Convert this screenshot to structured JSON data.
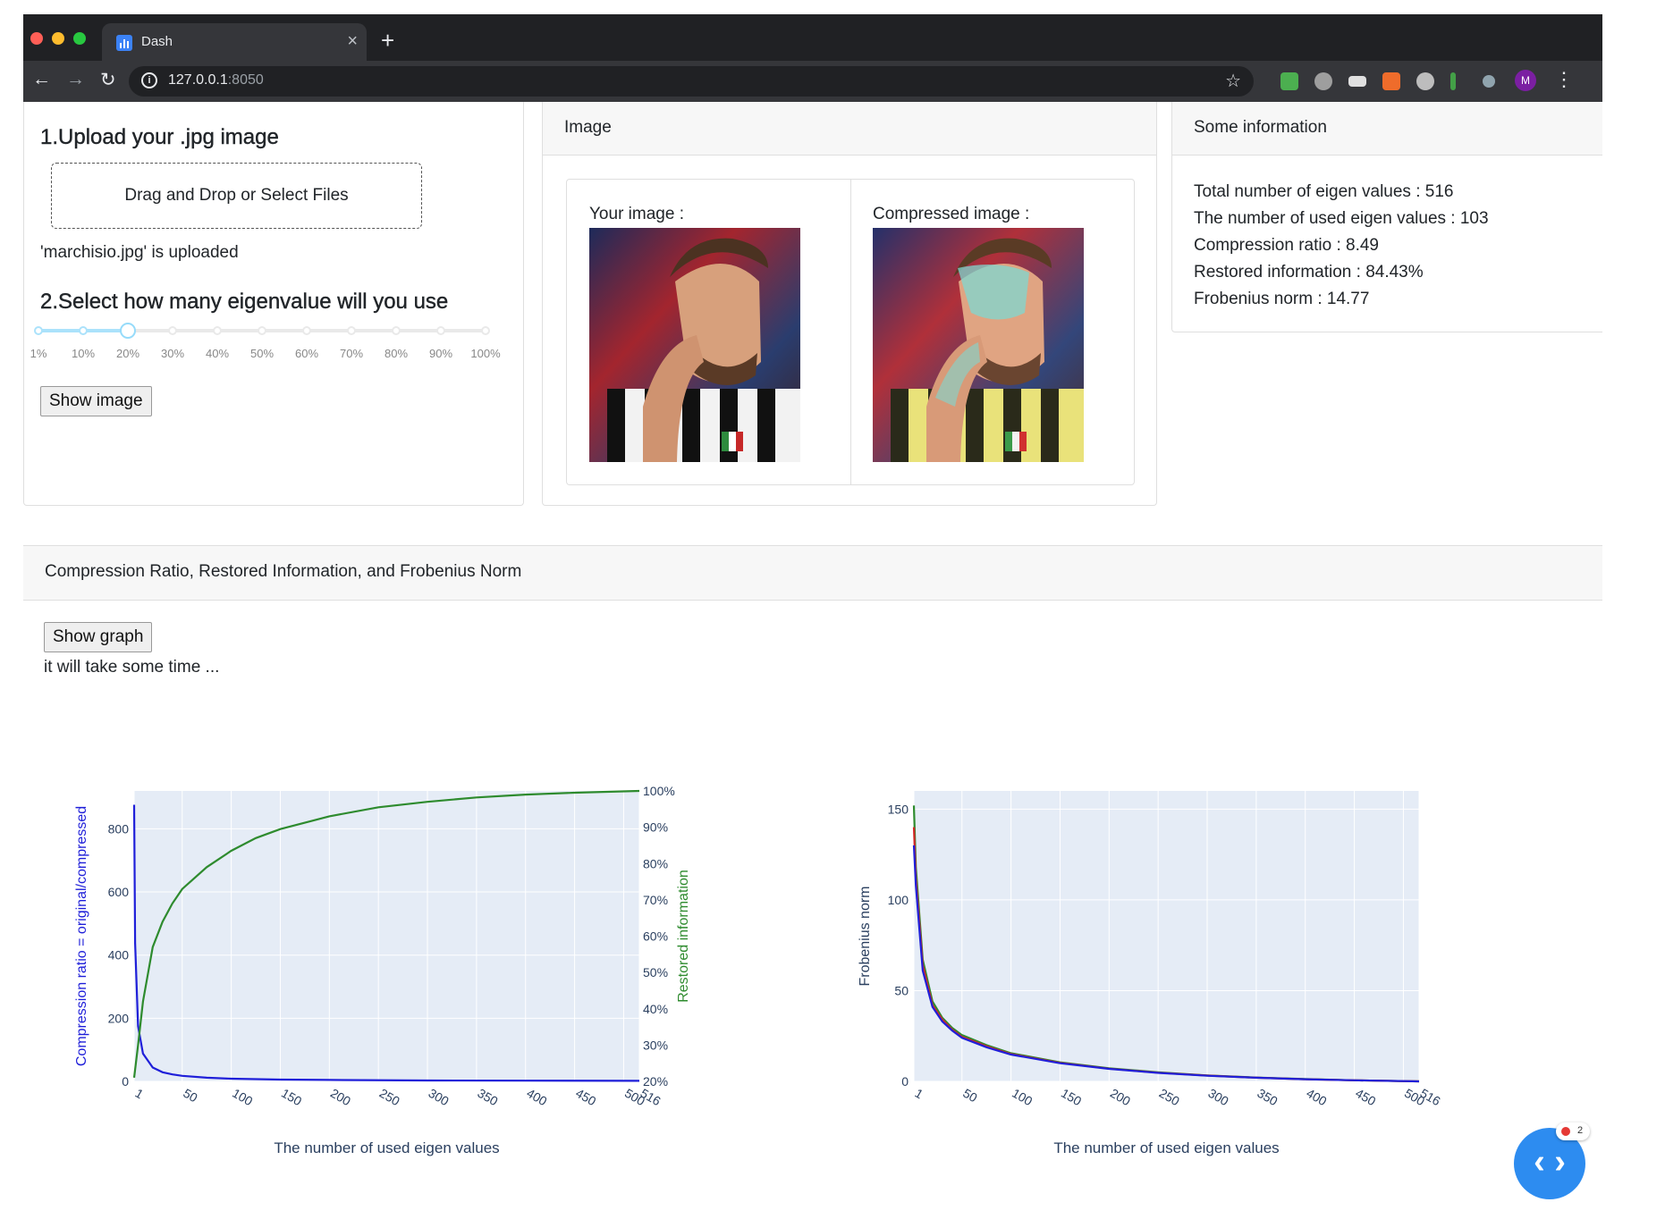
{
  "browser": {
    "tab_title": "Dash",
    "tab_close": "×",
    "new_tab": "+",
    "url_host": "127.0.0.1",
    "url_port": ":8050",
    "avatar_letter": "M",
    "back": "←",
    "forward": "→",
    "reload": "↻",
    "star": "☆",
    "menu": "⋮"
  },
  "upload_panel": {
    "heading": "1.Upload your .jpg image",
    "dropzone": "Drag and Drop or Select Files",
    "status": "'marchisio.jpg' is uploaded",
    "slider_heading": "2.Select how many eigenvalue will you use",
    "slider_marks": [
      "1%",
      "10%",
      "20%",
      "30%",
      "40%",
      "50%",
      "60%",
      "70%",
      "80%",
      "90%",
      "100%"
    ],
    "slider_value": "20%",
    "show_image_button": "Show image"
  },
  "image_panel": {
    "header": "Image",
    "your_image_label": "Your image :",
    "compressed_image_label": "Compressed image :"
  },
  "info_panel": {
    "header": "Some information",
    "lines": [
      "Total number of eigen values : 516",
      "The number of used eigen values : 103",
      "Compression ratio : 8.49",
      "Restored information : 84.43%",
      "Frobenius norm : 14.77"
    ]
  },
  "graph_panel": {
    "header": "Compression Ratio, Restored Information, and Frobenius Norm",
    "show_graph_button": "Show graph",
    "note": "it will take some time ..."
  },
  "fab": {
    "icon": "‹ ›",
    "badge_count": "2"
  },
  "colors": {
    "ratio_line": "#1f1fd9",
    "restored_line": "#2e8b2e",
    "plot_bg": "#e5ecf6",
    "fab": "#2d8cf0"
  },
  "chart_data": [
    {
      "type": "line",
      "xlabel": "The number of used eigen values",
      "ylabel": "Compression ratio = original/compressed",
      "y2label": "Restored information",
      "x_ticks": [
        "1",
        "50",
        "100",
        "150",
        "200",
        "250",
        "300",
        "350",
        "400",
        "450",
        "500",
        "516"
      ],
      "y_ticks": [
        "0",
        "200",
        "400",
        "600",
        "800"
      ],
      "y2_ticks": [
        "20%",
        "30%",
        "40%",
        "50%",
        "60%",
        "70%",
        "80%",
        "90%",
        "100%"
      ],
      "xlim": [
        1,
        516
      ],
      "ylim": [
        0,
        920
      ],
      "y2lim": [
        20,
        100
      ],
      "series": [
        {
          "name": "Compression ratio",
          "axis": "y",
          "x": [
            1,
            2,
            5,
            10,
            20,
            30,
            40,
            50,
            75,
            100,
            150,
            200,
            300,
            400,
            516
          ],
          "y": [
            876,
            438,
            175,
            88,
            44,
            29,
            22,
            17.5,
            11.7,
            8.5,
            5.8,
            4.4,
            2.9,
            2.2,
            1.7
          ]
        },
        {
          "name": "Restored information",
          "axis": "y2",
          "x": [
            1,
            5,
            10,
            20,
            30,
            40,
            50,
            75,
            100,
            125,
            150,
            200,
            250,
            300,
            350,
            400,
            450,
            516
          ],
          "y": [
            21,
            30,
            42,
            57,
            64,
            69,
            73,
            79,
            83.5,
            87,
            89.5,
            93,
            95.5,
            97,
            98.2,
            99,
            99.5,
            100
          ]
        }
      ]
    },
    {
      "type": "line",
      "xlabel": "The number of used eigen values",
      "ylabel": "Frobenius norm",
      "x_ticks": [
        "1",
        "50",
        "100",
        "150",
        "200",
        "250",
        "300",
        "350",
        "400",
        "450",
        "500",
        "516"
      ],
      "y_ticks": [
        "0",
        "50",
        "100",
        "150"
      ],
      "xlim": [
        1,
        516
      ],
      "ylim": [
        0,
        160
      ],
      "series": [
        {
          "color": "#2e8b2e",
          "x": [
            1,
            3,
            10,
            20,
            30,
            40,
            50,
            75,
            100,
            150,
            200,
            250,
            300,
            350,
            400,
            450,
            516
          ],
          "y": [
            152,
            118,
            67,
            44,
            35,
            29.5,
            25.5,
            20,
            15.5,
            10.5,
            7.2,
            5,
            3.3,
            2.1,
            1.3,
            0.6,
            0
          ]
        },
        {
          "color": "#d62728",
          "x": [
            1,
            3,
            10,
            20,
            30,
            40,
            50,
            75,
            100,
            150,
            200,
            250,
            300,
            350,
            400,
            450,
            516
          ],
          "y": [
            140,
            112,
            64,
            42,
            34,
            28.5,
            24.5,
            19.3,
            15,
            10.2,
            7,
            4.8,
            3.2,
            2,
            1.2,
            0.6,
            0
          ]
        },
        {
          "color": "#1f1fd9",
          "x": [
            1,
            3,
            10,
            20,
            30,
            40,
            50,
            75,
            100,
            150,
            200,
            250,
            300,
            350,
            400,
            450,
            516
          ],
          "y": [
            130,
            108,
            61,
            41,
            33,
            28,
            24,
            18.8,
            14.77,
            10,
            6.9,
            4.7,
            3.1,
            2,
            1.2,
            0.6,
            0
          ]
        }
      ]
    }
  ]
}
